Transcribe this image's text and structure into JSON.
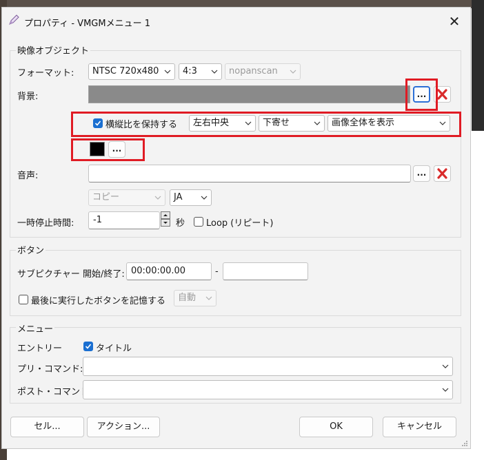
{
  "window": {
    "title": "プロパティ - VMGMメニュー 1",
    "close_glyph": "✕"
  },
  "video_group": {
    "label": "映像オブジェクト",
    "format_label": "フォーマット:",
    "format_value": "NTSC 720x480",
    "aspect_value": "4:3",
    "pan_value": "nopanscan",
    "background_label": "背景:",
    "background_color": "#8a8a8a",
    "browse_label": "...",
    "keep_aspect_label": "横縦比を保持する",
    "keep_aspect_checked": true,
    "halign_value": "左右中央",
    "valign_value": "下寄せ",
    "fit_value": "画像全体を表示",
    "fill_color": "#000000",
    "audio_label": "音声:",
    "audio_value": "",
    "audio_mode_value": "コピー",
    "audio_lang_value": "JA",
    "pause_label": "一時停止時間:",
    "pause_value": "-1",
    "pause_unit": "秒",
    "loop_label": "Loop (リピート)",
    "loop_checked": false
  },
  "buttons_group": {
    "label": "ボタン",
    "subpicture_label": "サブピクチャー 開始/終了:",
    "start_value": "00:00:00.00",
    "separator": "-",
    "end_value": "",
    "remember_label": "最後に実行したボタンを記憶する",
    "remember_checked": false,
    "remember_mode_value": "自動"
  },
  "menu_group": {
    "label": "メニュー",
    "entry_label": "エントリー",
    "title_check_label": "タイトル",
    "title_checked": true,
    "pre_command_label": "プリ・コマンド:",
    "pre_command_value": "",
    "post_command_label": "ポスト・コマンド:",
    "post_command_value": ""
  },
  "footer": {
    "cell_button": "セル...",
    "action_button": "アクション...",
    "ok_button": "OK",
    "cancel_button": "キャンセル"
  },
  "colors": {
    "accent": "#1a6fd1",
    "highlight_box": "#e01b24",
    "delete_red": "#d92b2b"
  }
}
